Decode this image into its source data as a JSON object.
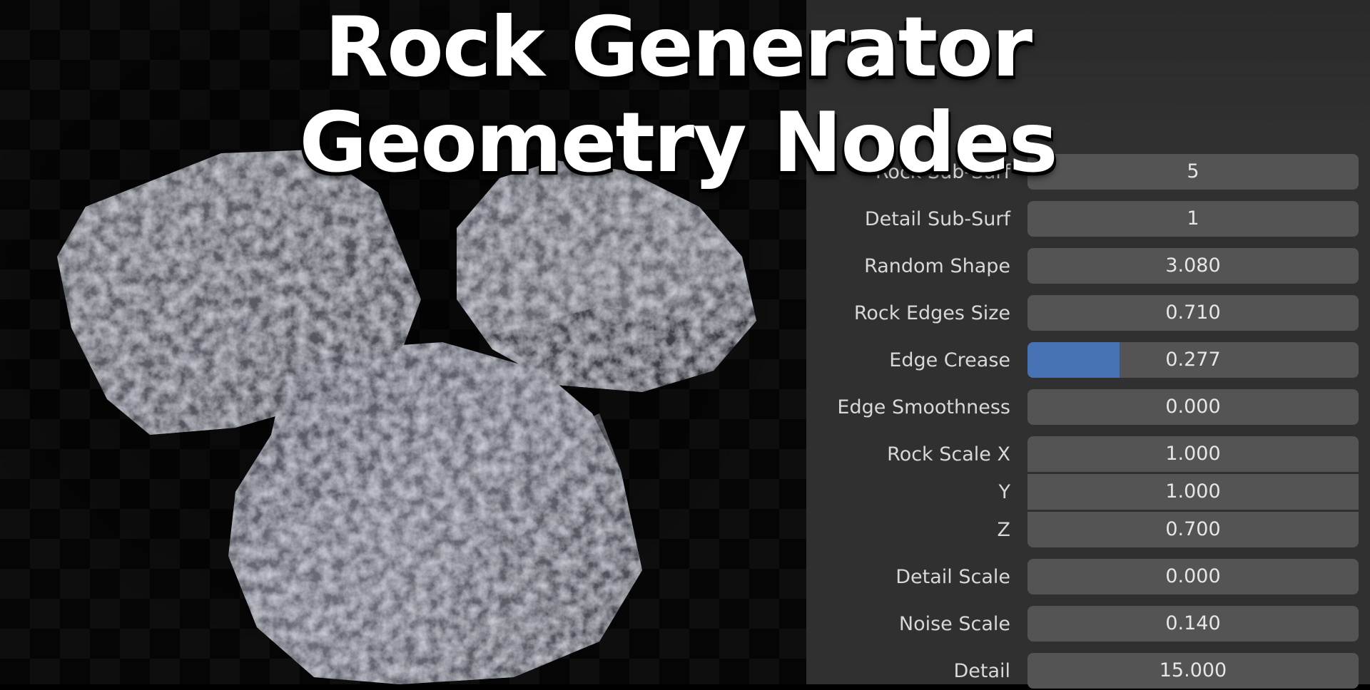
{
  "title": {
    "line1": "Rock Generator",
    "line2": "Geometry Nodes"
  },
  "panel": {
    "properties": [
      {
        "label": "Rock Sub-Surf",
        "value": "5"
      },
      {
        "label": "Detail Sub-Surf",
        "value": "1"
      },
      {
        "label": "Random Shape",
        "value": "3.080"
      },
      {
        "label": "Rock Edges Size",
        "value": "0.710"
      },
      {
        "label": "Edge Crease",
        "value": "0.277",
        "fill_fraction": 0.277
      },
      {
        "label": "Edge Smoothness",
        "value": "0.000"
      },
      {
        "label": "Rock Scale X",
        "value": "1.000"
      },
      {
        "label": "Y",
        "value": "1.000"
      },
      {
        "label": "Z",
        "value": "0.700"
      },
      {
        "label": "Detail Scale",
        "value": "0.000"
      },
      {
        "label": "Noise Scale",
        "value": "0.140"
      },
      {
        "label": "Detail",
        "value": "15.000"
      }
    ]
  },
  "colors": {
    "panel_bg": "#303030",
    "field_bg": "#545454",
    "slider_fill": "#4772b3",
    "title_text": "#ffffff"
  }
}
